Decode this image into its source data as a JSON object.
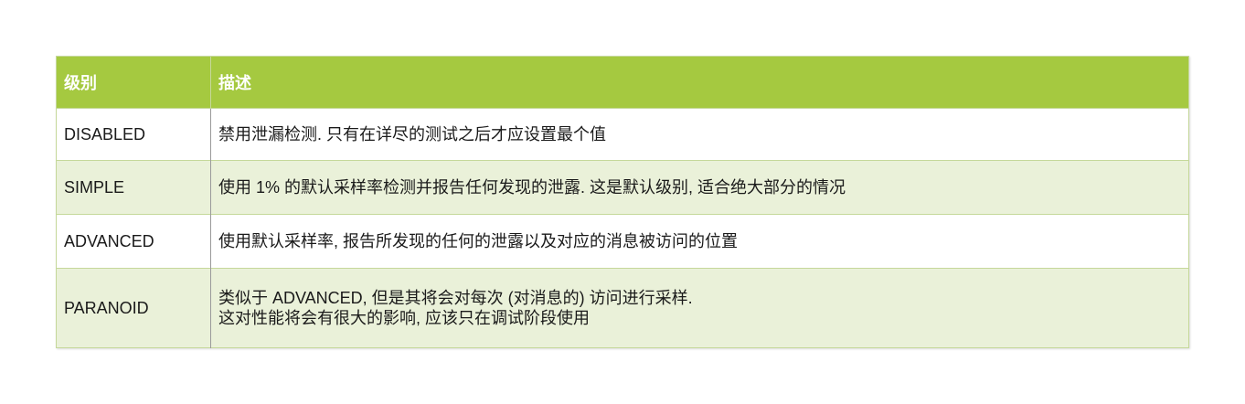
{
  "table": {
    "headers": {
      "level": "级别",
      "description": "描述"
    },
    "rows": [
      {
        "level": "DISABLED",
        "description": [
          "禁用泄漏检测. 只有在详尽的测试之后才应设置最个值"
        ]
      },
      {
        "level": "SIMPLE",
        "description": [
          "使用 1% 的默认采样率检测并报告任何发现的泄露. 这是默认级别, 适合绝大部分的情况"
        ]
      },
      {
        "level": "ADVANCED",
        "description": [
          "使用默认采样率, 报告所发现的任何的泄露以及对应的消息被访问的位置"
        ]
      },
      {
        "level": "PARANOID",
        "description": [
          "类似于 ADVANCED, 但是其将会对每次 (对消息的) 访问进行采样.",
          "这对性能将会有很大的影响, 应该只在调试阶段使用"
        ]
      }
    ],
    "colors": {
      "header_bg": "#a5c940",
      "header_text": "#ffffff",
      "stripe_bg": "#eaf1d9",
      "border": "#c5d89a"
    }
  }
}
